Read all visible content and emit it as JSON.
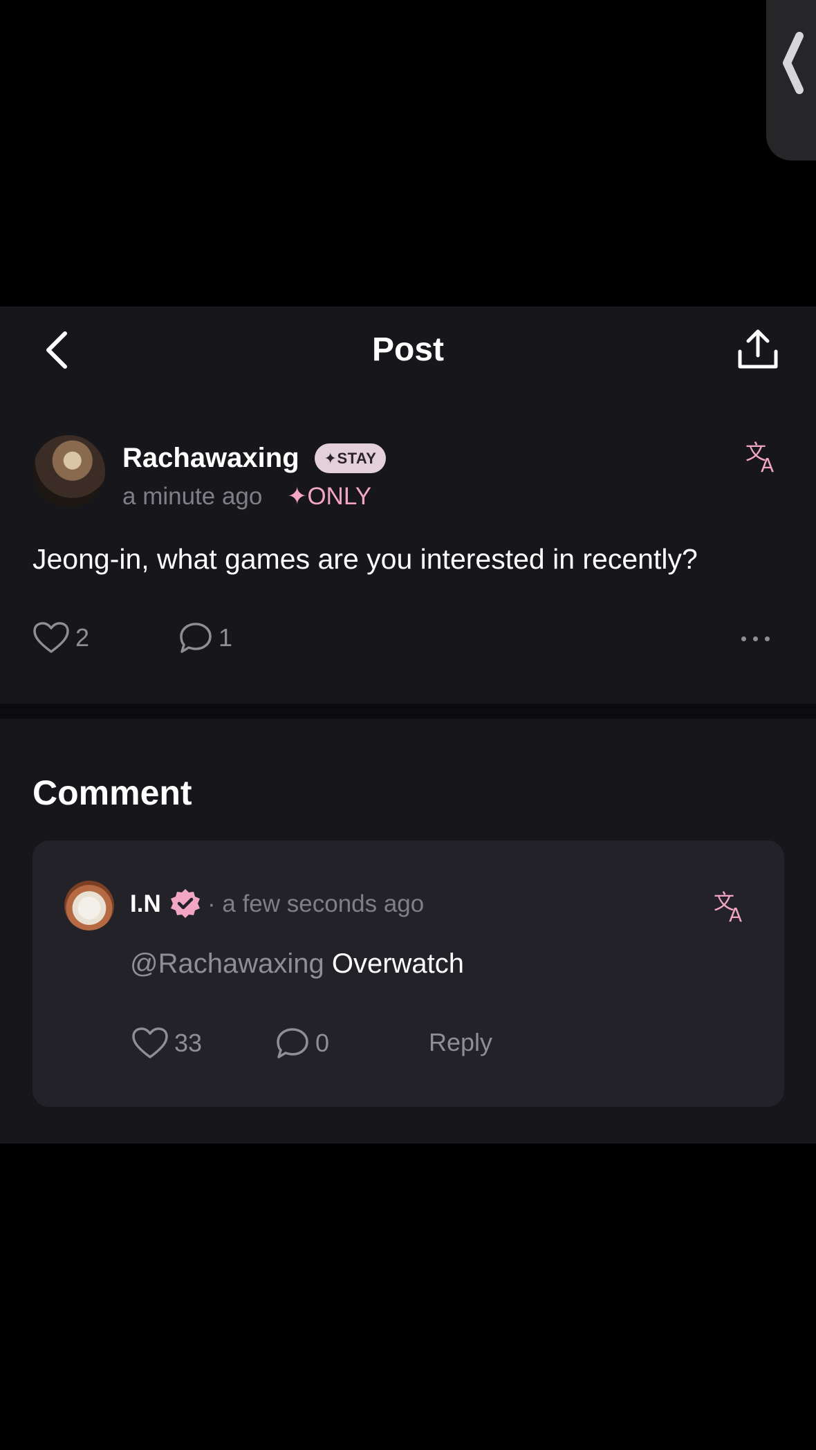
{
  "header": {
    "title": "Post"
  },
  "post": {
    "author": "Rachawaxing",
    "badge": "✦STAY",
    "time": "a minute ago",
    "visibility": "✦ONLY",
    "body": "Jeong-in, what games are you interested in recently?",
    "likes": "2",
    "comments": "1"
  },
  "comments_section": {
    "heading": "Comment",
    "items": [
      {
        "author": "I.N",
        "time": "· a few seconds ago",
        "mention": "@Rachawaxing",
        "text": " Overwatch",
        "likes": "33",
        "replies": "0",
        "reply_label": "Reply"
      }
    ]
  },
  "colors": {
    "accent": "#f2a6c4",
    "panel": "#16161b",
    "card": "#222228",
    "muted": "#8e8e95"
  },
  "icons": [
    "side-tab-chevron-icon",
    "back-icon",
    "share-icon",
    "translate-icon",
    "heart-icon",
    "comment-icon",
    "more-icon",
    "verified-icon"
  ]
}
